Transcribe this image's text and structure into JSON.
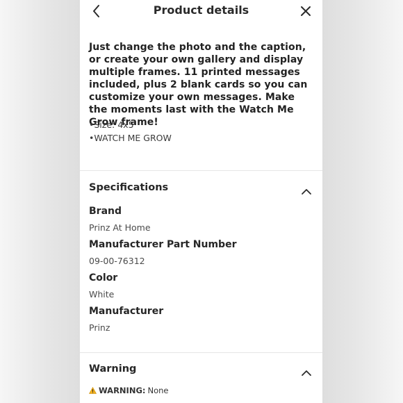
{
  "header": {
    "title": "Product details"
  },
  "description": {
    "text": "Just change the photo and the caption, or create your own gallery and display multiple frames. 11 printed messages included, plus 2 blank cards so you can customize your own messages. Make the moments last with the Watch Me Grow frame!",
    "bullets": [
      "•Size: 4x5",
      "•WATCH ME GROW"
    ]
  },
  "specifications": {
    "heading": "Specifications",
    "items": [
      {
        "label": "Brand",
        "value": "Prinz At Home"
      },
      {
        "label": "Manufacturer Part Number",
        "value": "09-00-76312"
      },
      {
        "label": "Color",
        "value": "White"
      },
      {
        "label": "Manufacturer",
        "value": "Prinz"
      }
    ]
  },
  "warning": {
    "heading": "Warning",
    "label": "WARNING:",
    "value": "None",
    "icon_color": "#f2b01e"
  },
  "icons": {
    "back": "chevron-left-icon",
    "close": "close-icon",
    "collapse": "chevron-up-icon",
    "warning": "warning-triangle-icon"
  }
}
